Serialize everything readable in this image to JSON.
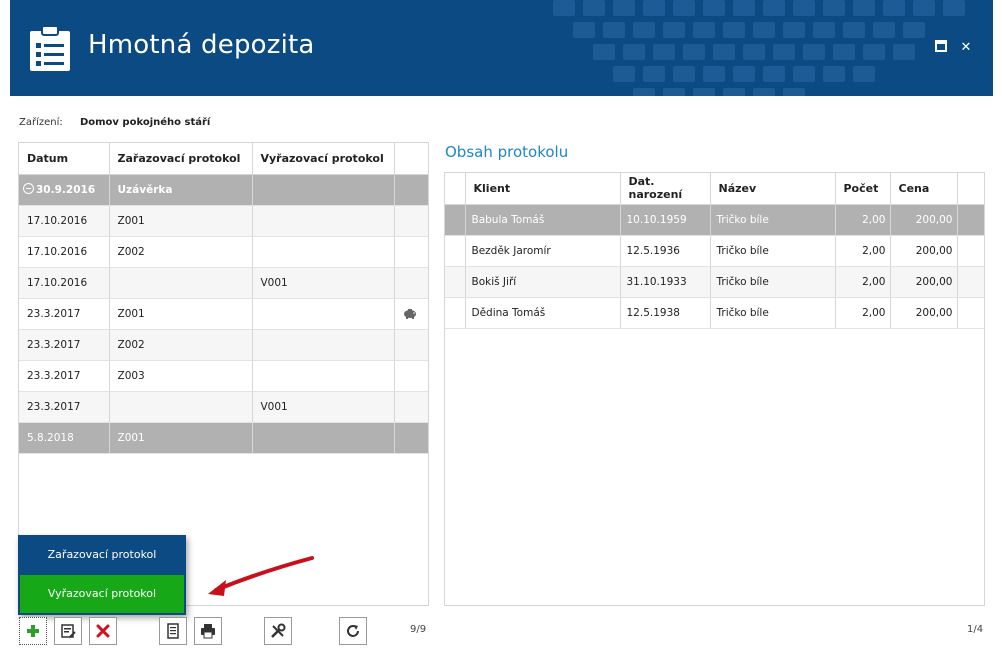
{
  "header": {
    "title": "Hmotná depozita",
    "colors": {
      "background": "#0b4a82"
    }
  },
  "facility": {
    "label": "Zařízení:",
    "value": "Domov pokojného stáří"
  },
  "left_table": {
    "columns": [
      "Datum",
      "Zařazovací protokol",
      "Vyřazovací protokol"
    ],
    "group": {
      "date": "30.9.2016",
      "label": "Uzávěrka"
    },
    "rows": [
      {
        "date": "17.10.2016",
        "in": "Z001",
        "out": "",
        "icon": ""
      },
      {
        "date": "17.10.2016",
        "in": "Z002",
        "out": "",
        "icon": ""
      },
      {
        "date": "17.10.2016",
        "in": "",
        "out": "V001",
        "icon": ""
      },
      {
        "date": "23.3.2017",
        "in": "Z001",
        "out": "",
        "icon": "piggy-bank-icon"
      },
      {
        "date": "23.3.2017",
        "in": "Z002",
        "out": "",
        "icon": ""
      },
      {
        "date": "23.3.2017",
        "in": "Z003",
        "out": "",
        "icon": ""
      },
      {
        "date": "23.3.2017",
        "in": "",
        "out": "V001",
        "icon": ""
      },
      {
        "date": "5.8.2018",
        "in": "Z001",
        "out": "",
        "icon": ""
      }
    ],
    "counter": "9/9"
  },
  "popup_menu": {
    "items": [
      "Zařazovací protokol",
      "Vyřazovací protokol"
    ],
    "highlight_color": "#17a817"
  },
  "right_panel": {
    "title": "Obsah protokolu",
    "columns": [
      "Klient",
      "Dat. narození",
      "Název",
      "Počet",
      "Cena"
    ],
    "rows": [
      {
        "client": "Babula Tomáš",
        "birth": "10.10.1959",
        "name": "Tričko bíle",
        "count": "2,00",
        "price": "200,00"
      },
      {
        "client": "Bezděk Jaromír",
        "birth": "12.5.1936",
        "name": "Tričko bíle",
        "count": "2,00",
        "price": "200,00"
      },
      {
        "client": "Bokiš Jiří",
        "birth": "31.10.1933",
        "name": "Tričko bíle",
        "count": "2,00",
        "price": "200,00"
      },
      {
        "client": "Dědina Tomáš",
        "birth": "12.5.1938",
        "name": "Tričko bíle",
        "count": "2,00",
        "price": "200,00"
      }
    ],
    "counter": "1/4"
  },
  "toolbar": {
    "icons": [
      "plus-icon",
      "edit-icon",
      "delete-icon",
      "document-icon",
      "print-icon",
      "tools-icon",
      "refresh-icon"
    ]
  }
}
